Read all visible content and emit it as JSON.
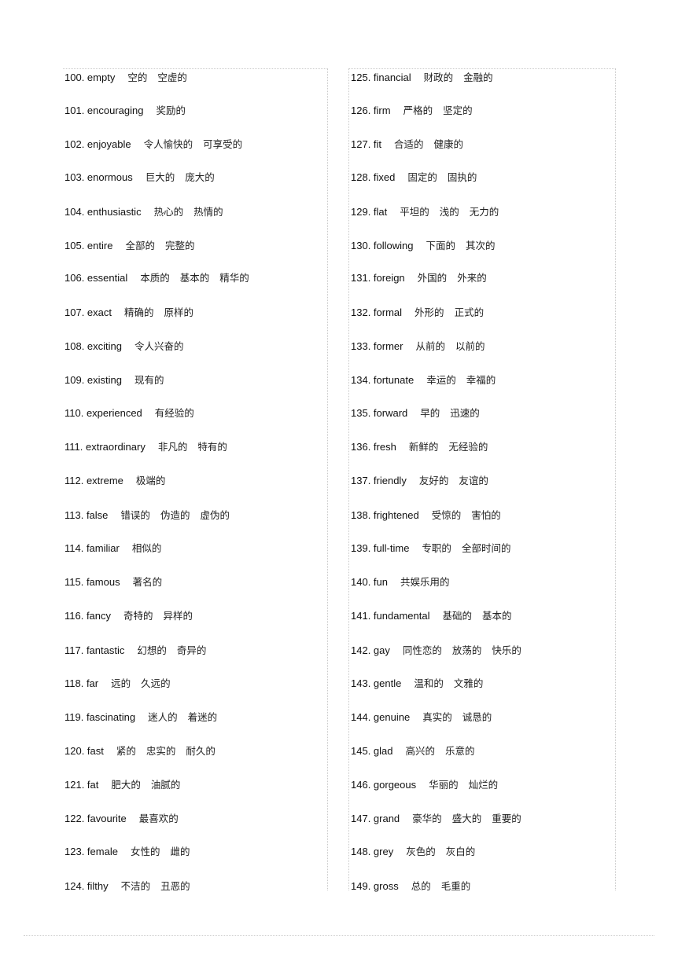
{
  "left_column": [
    {
      "word": "100. empty",
      "meanings": [
        "空的",
        "空虚的"
      ]
    },
    {
      "word": "101. encouraging",
      "meanings": [
        "奖励的"
      ]
    },
    {
      "word": "102. enjoyable",
      "meanings": [
        "令人愉快的",
        "可享受的"
      ]
    },
    {
      "word": "103. enormous",
      "meanings": [
        "巨大的",
        "庞大的"
      ]
    },
    {
      "word": "104. enthusiastic",
      "meanings": [
        "热心的",
        "热情的"
      ]
    },
    {
      "word": "105. entire",
      "meanings": [
        "全部的",
        "完整的"
      ]
    },
    {
      "word": "106. essential",
      "meanings": [
        "本质的",
        "基本的",
        "精华的"
      ]
    },
    {
      "word": "107. exact",
      "meanings": [
        "精确的",
        "原样的"
      ]
    },
    {
      "word": "108. exciting",
      "meanings": [
        "令人兴奋的"
      ]
    },
    {
      "word": "109. existing",
      "meanings": [
        "现有的"
      ]
    },
    {
      "word": "110. experienced",
      "meanings": [
        "有经验的"
      ]
    },
    {
      "word": "111. extraordinary",
      "meanings": [
        "非凡的",
        "特有的"
      ]
    },
    {
      "word": "112. extreme",
      "meanings": [
        "极端的"
      ]
    },
    {
      "word": "113. false",
      "meanings": [
        "错误的",
        "伪造的",
        "虚伪的"
      ]
    },
    {
      "word": "114. familiar",
      "meanings": [
        "相似的"
      ]
    },
    {
      "word": "115. famous",
      "meanings": [
        "著名的"
      ]
    },
    {
      "word": "116. fancy",
      "meanings": [
        "奇特的",
        "异样的"
      ]
    },
    {
      "word": "117. fantastic",
      "meanings": [
        "幻想的",
        "奇异的"
      ]
    },
    {
      "word": "118. far",
      "meanings": [
        "远的",
        "久远的"
      ]
    },
    {
      "word": "119. fascinating",
      "meanings": [
        "迷人的",
        "着迷的"
      ]
    },
    {
      "word": "120. fast",
      "meanings": [
        "紧的",
        "忠实的",
        "耐久的"
      ]
    },
    {
      "word": "121. fat",
      "meanings": [
        "肥大的",
        "油腻的"
      ]
    },
    {
      "word": "122. favourite",
      "meanings": [
        "最喜欢的"
      ]
    },
    {
      "word": "123. female",
      "meanings": [
        "女性的",
        "雌的"
      ]
    },
    {
      "word": "124. filthy",
      "meanings": [
        "不洁的",
        "丑恶的"
      ]
    }
  ],
  "right_column": [
    {
      "word": "125. financial",
      "meanings": [
        "财政的",
        "金融的"
      ]
    },
    {
      "word": "126. firm",
      "meanings": [
        "严格的",
        "坚定的"
      ]
    },
    {
      "word": "127. fit",
      "meanings": [
        "合适的",
        "健康的"
      ]
    },
    {
      "word": "128. fixed",
      "meanings": [
        "固定的",
        "固执的"
      ]
    },
    {
      "word": "129. flat",
      "meanings": [
        "平坦的",
        "浅的",
        "无力的"
      ]
    },
    {
      "word": "130. following",
      "meanings": [
        "下面的",
        "其次的"
      ]
    },
    {
      "word": "131. foreign",
      "meanings": [
        "外国的",
        "外来的"
      ]
    },
    {
      "word": "132. formal",
      "meanings": [
        "外形的",
        "正式的"
      ]
    },
    {
      "word": "133. former",
      "meanings": [
        "从前的",
        "以前的"
      ]
    },
    {
      "word": "134. fortunate",
      "meanings": [
        "幸运的",
        "幸福的"
      ]
    },
    {
      "word": "135. forward",
      "meanings": [
        "早的",
        "迅速的"
      ]
    },
    {
      "word": "136. fresh",
      "meanings": [
        "新鲜的",
        "无经验的"
      ]
    },
    {
      "word": "137. friendly",
      "meanings": [
        "友好的",
        "友谊的"
      ]
    },
    {
      "word": "138. frightened",
      "meanings": [
        "受惊的",
        "害怕的"
      ]
    },
    {
      "word": "139. full-time",
      "meanings": [
        "专职的",
        "全部时间的"
      ]
    },
    {
      "word": "140. fun",
      "meanings": [
        "共娱乐用的"
      ]
    },
    {
      "word": "141. fundamental",
      "meanings": [
        "基础的",
        "基本的"
      ]
    },
    {
      "word": "142. gay",
      "meanings": [
        "同性恋的",
        "放荡的",
        "快乐的"
      ]
    },
    {
      "word": "143. gentle",
      "meanings": [
        "温和的",
        "文雅的"
      ]
    },
    {
      "word": "144. genuine",
      "meanings": [
        "真实的",
        "诚恳的"
      ]
    },
    {
      "word": "145. glad",
      "meanings": [
        "高兴的",
        "乐意的"
      ]
    },
    {
      "word": "146. gorgeous",
      "meanings": [
        "华丽的",
        "灿烂的"
      ]
    },
    {
      "word": "147. grand",
      "meanings": [
        "豪华的",
        "盛大的",
        "重要的"
      ]
    },
    {
      "word": "148. grey",
      "meanings": [
        "灰色的",
        "灰白的"
      ]
    },
    {
      "word": "149. gross",
      "meanings": [
        "总的",
        "毛重的"
      ]
    }
  ]
}
